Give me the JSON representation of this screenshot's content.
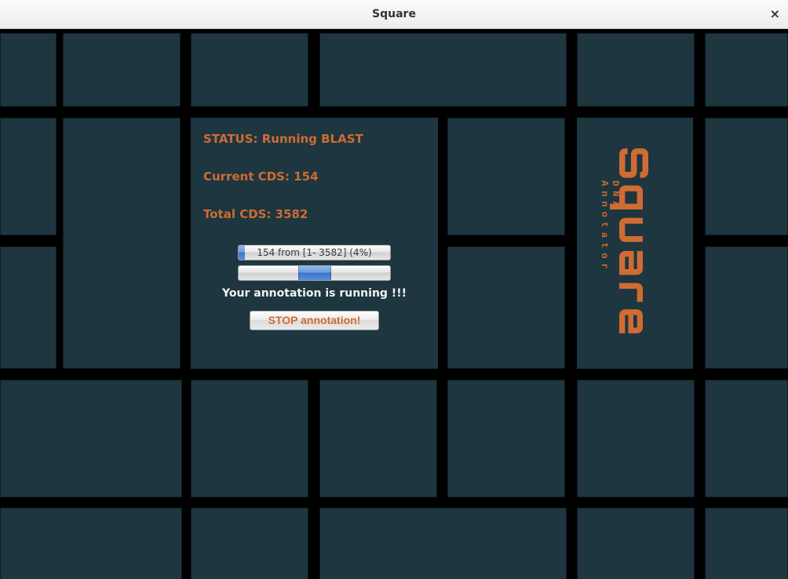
{
  "window": {
    "title": "Square",
    "close_glyph": "×"
  },
  "status": {
    "status_line": "STATUS: Running BLAST",
    "current_line": "Current CDS: 154",
    "total_line": "Total CDS: 3582",
    "progress_text": "154 from [1- 3582] (4%)",
    "progress_percent": 4,
    "running_text": "Your annotation is running !!!",
    "stop_label": "STOP annotation!"
  },
  "logo": {
    "main": "Square",
    "sub": "DNA Annotator"
  }
}
